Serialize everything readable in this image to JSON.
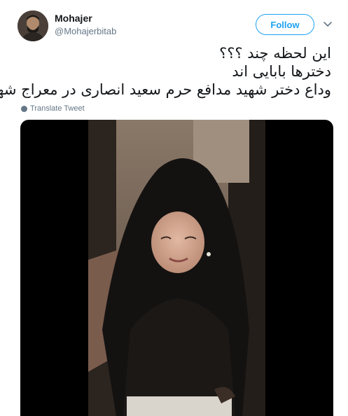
{
  "user": {
    "name": "Mohajer",
    "handle": "@Mohajerbitab"
  },
  "actions": {
    "follow_label": "Follow"
  },
  "tweet": {
    "lines": [
      "این لحظه چند ؟؟؟",
      "دخترها بابایی اند",
      "وداع دختر شهید مدافع حرم سعید انصاری در معراج شهدا"
    ]
  },
  "translate_label": "Translate Tweet",
  "colors": {
    "accent": "#1da1f2",
    "secondary_text": "#657786",
    "primary_text": "#14171a",
    "media_background": "#000000"
  },
  "icons": {
    "more": "chevron-down-icon",
    "translate": "globe-icon"
  }
}
